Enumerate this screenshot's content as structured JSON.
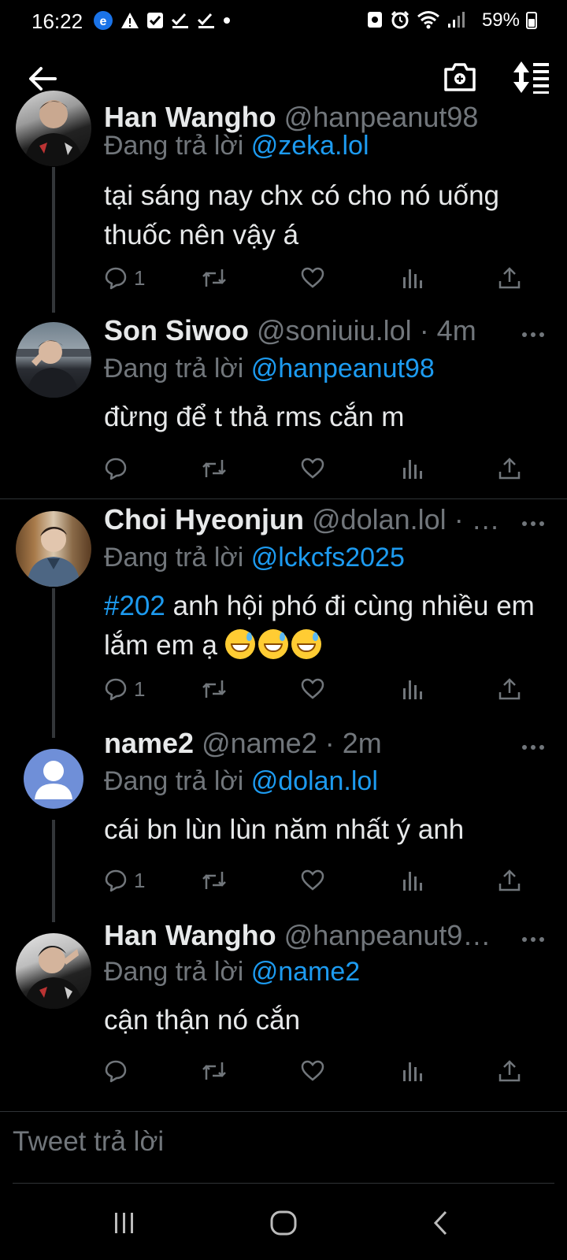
{
  "status_bar": {
    "time": "16:22",
    "battery": "59%"
  },
  "tweets": [
    {
      "name": "Han Wangho",
      "handle": "@hanpeanut98",
      "time": "",
      "replying_to_label": "Đang trả lời ",
      "replying_to": "@zeka.lol",
      "body": "tại sáng nay chx có cho nó uống thuốc nên vậy á",
      "reply_count": "1"
    },
    {
      "name": "Son Siwoo",
      "handle": "@soniuiu.lol",
      "time": "· 4m",
      "replying_to_label": "Đang trả lời ",
      "replying_to": "@hanpeanut98",
      "body": "đừng để t thả rms cắn m",
      "reply_count": ""
    },
    {
      "name": "Choi Hyeonjun",
      "handle": "@dolan.lol",
      "time": "· …",
      "replying_to_label": "Đang trả lời ",
      "replying_to": "@lckcfs2025",
      "body_hashtag": "#202",
      "body": " anh hội phó đi cùng nhiều em lắm em ạ ",
      "reply_count": "1"
    },
    {
      "name": "name2",
      "handle": "@name2",
      "time": "· 2m",
      "replying_to_label": "Đang trả lời ",
      "replying_to": "@dolan.lol",
      "body": "cái bn lùn lùn năm nhất ý anh",
      "reply_count": "1"
    },
    {
      "name": "Han Wangho",
      "handle": "@hanpeanut9…",
      "time": "",
      "replying_to_label": "Đang trả lời ",
      "replying_to": "@name2",
      "body": "cận thận nó cắn",
      "reply_count": ""
    }
  ],
  "composer": {
    "placeholder": "Tweet trả lời"
  },
  "colors": {
    "background": "#000000",
    "accent": "#1d9bf0",
    "secondary_text": "#71767b",
    "primary_text": "#e7e9ea"
  },
  "icons": [
    "back-arrow-icon",
    "camera-icon",
    "sort-icon",
    "reply-icon",
    "retweet-icon",
    "like-icon",
    "analytics-icon",
    "share-icon",
    "more-icon"
  ]
}
